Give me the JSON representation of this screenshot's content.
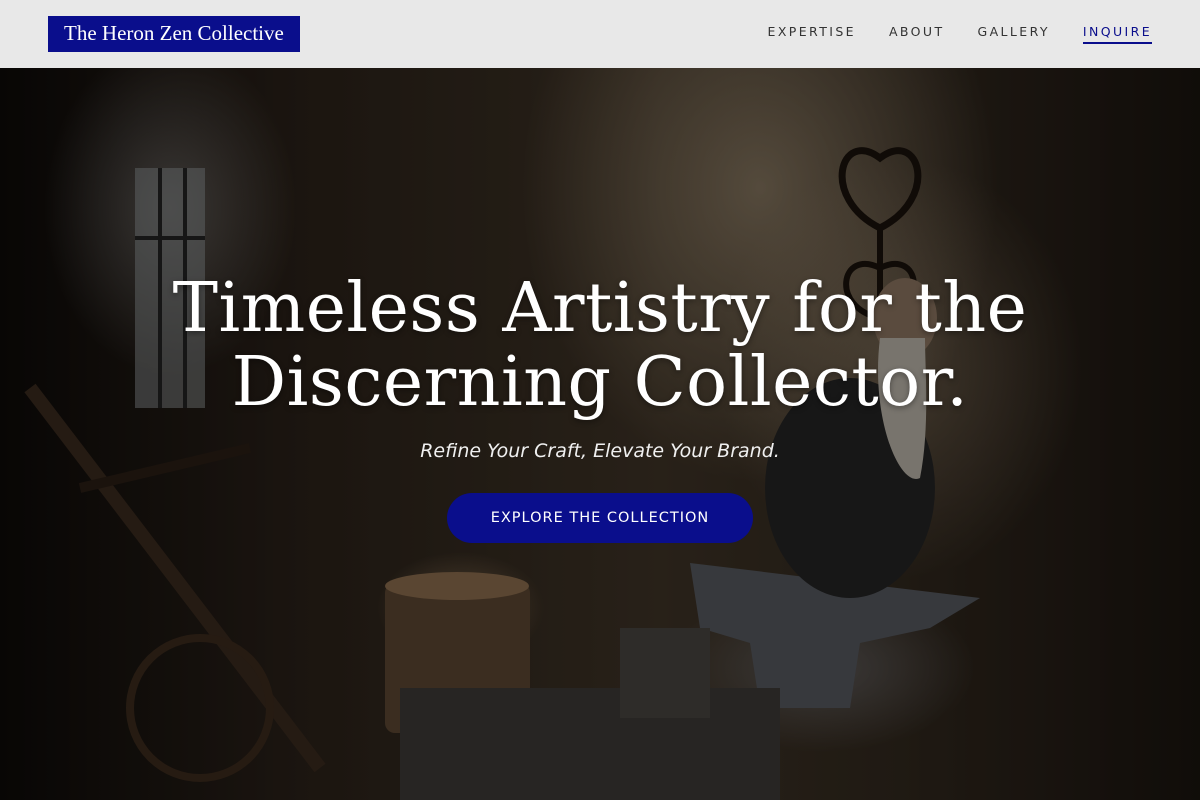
{
  "header": {
    "logo_text": "The Heron Zen Collective",
    "nav": [
      {
        "label": "EXPERTISE"
      },
      {
        "label": "ABOUT"
      },
      {
        "label": "GALLERY"
      },
      {
        "label": "INQUIRE",
        "active": true
      }
    ]
  },
  "hero": {
    "headline_line1": "Timeless Artistry for the",
    "headline_line2": "Discerning Collector.",
    "subheadline": "Refine Your Craft, Elevate Your Brand.",
    "cta_label": "EXPLORE THE COLLECTION",
    "background": "blacksmith-workshop-photo"
  },
  "colors": {
    "brand": "#0a0e8c",
    "header_bg": "#e8e8e8",
    "nav_text": "#333333",
    "hero_text": "#ffffff"
  }
}
